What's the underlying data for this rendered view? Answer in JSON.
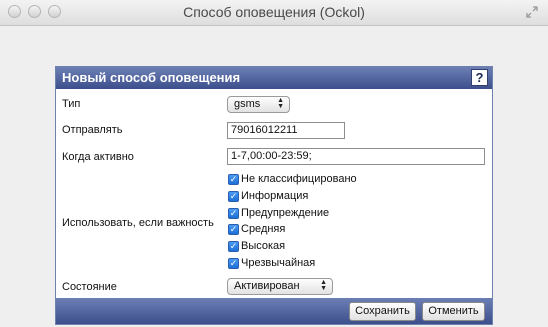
{
  "window": {
    "title": "Способ оповещения (Ockol)"
  },
  "panel": {
    "title": "Новый способ оповещения",
    "help_label": "?"
  },
  "form": {
    "type_label": "Тип",
    "type_value": "gsms",
    "send_label": "Отправлять",
    "send_value": "79016012211",
    "active_label": "Когда активно",
    "active_value": "1-7,00:00-23:59;",
    "severity_label": "Использовать, если важность",
    "severities": [
      {
        "label": "Не классифицировано",
        "checked": true
      },
      {
        "label": "Информация",
        "checked": true
      },
      {
        "label": "Предупреждение",
        "checked": true
      },
      {
        "label": "Средняя",
        "checked": true
      },
      {
        "label": "Высокая",
        "checked": true
      },
      {
        "label": "Чрезвычайная",
        "checked": true
      }
    ],
    "status_label": "Состояние",
    "status_value": "Активирован"
  },
  "buttons": {
    "save": "Сохранить",
    "cancel": "Отменить"
  }
}
